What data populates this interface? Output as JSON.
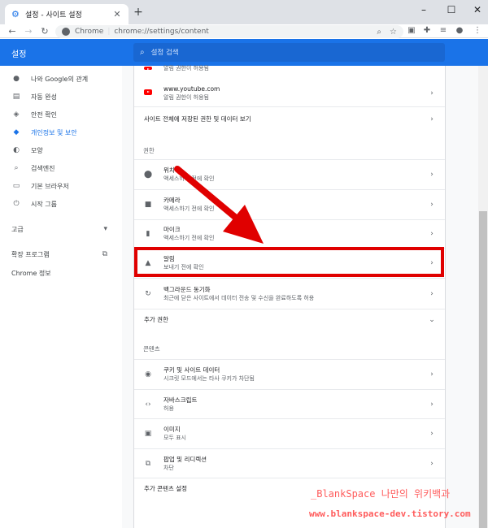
{
  "tab": {
    "title": "설정 - 사이트 설정"
  },
  "omnibox": {
    "host": "Chrome",
    "url": "chrome://settings/content"
  },
  "header": {
    "app_name": "설정",
    "search_placeholder": "설정 검색"
  },
  "sidebar": {
    "items": [
      {
        "label": "나와 Google의 관계",
        "icon": "person-icon"
      },
      {
        "label": "자동 완성",
        "icon": "clipboard-icon"
      },
      {
        "label": "안전 확인",
        "icon": "shield-check-icon"
      },
      {
        "label": "개인정보 및 보안",
        "icon": "shield-icon",
        "active": true
      },
      {
        "label": "모양",
        "icon": "palette-icon"
      },
      {
        "label": "검색엔진",
        "icon": "search-icon"
      },
      {
        "label": "기본 브라우저",
        "icon": "browser-icon"
      },
      {
        "label": "시작 그룹",
        "icon": "power-icon"
      }
    ],
    "advanced": "고급",
    "extensions": "확장 프로그램",
    "about": "Chrome 정보"
  },
  "content": {
    "partial_row_sub": "알림 권한이 허용됨",
    "youtube": {
      "title": "www.youtube.com",
      "sub": "알림 권한이 허용됨"
    },
    "all_sites": "사이트 전체에 저장된 권한 및 데이터 보기",
    "permissions_header": "권한",
    "location": {
      "title": "위치",
      "sub": "액세스하기 전에 확인"
    },
    "camera": {
      "title": "카메라",
      "sub": "액세스하기 전에 확인"
    },
    "mic": {
      "title": "마이크",
      "sub": "액세스하기 전에 확인"
    },
    "notifications": {
      "title": "알림",
      "sub": "보내기 전에 확인"
    },
    "bg_sync": {
      "title": "백그라운드 동기화",
      "sub": "최근에 닫은 사이트에서 데이터 전송 및 수신을 완료하도록 허용"
    },
    "more_permissions": "추가 권한",
    "content_header": "콘텐츠",
    "cookies": {
      "title": "쿠키 및 사이트 데이터",
      "sub": "시크릿 모드에서는 타사 쿠키가 차단됨"
    },
    "javascript": {
      "title": "자바스크립트",
      "sub": "허용"
    },
    "images": {
      "title": "이미지",
      "sub": "모두 표시"
    },
    "popups": {
      "title": "팝업 및 리디렉션",
      "sub": "차단"
    },
    "more_content": "추가 콘텐츠 설정"
  },
  "watermark": {
    "line1": "_BlankSpace 나만의 위키백과",
    "line2": "www.blankspace-dev.tistory.com"
  },
  "colors": {
    "brand": "#1a73e8",
    "highlight": "#e00000",
    "watermark": "#ff5c5c"
  }
}
